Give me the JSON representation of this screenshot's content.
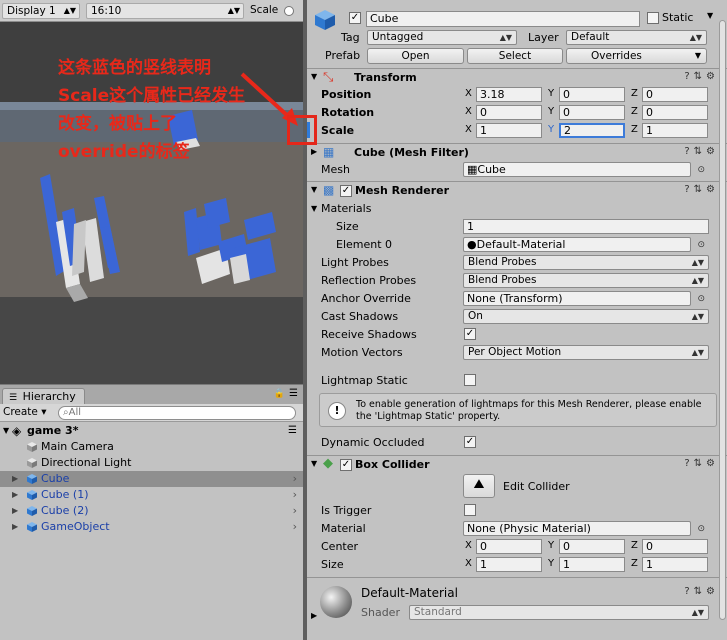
{
  "game_toolbar": {
    "display": "Display 1",
    "resolution": "16:10",
    "scale_label": "Scale"
  },
  "annotation": {
    "text": "这条蓝色的竖线表明Scale这个属性已经发生改变，被贴上了override的标签",
    "color": "#e8281a"
  },
  "hierarchy": {
    "tab_label": "Hierarchy",
    "create_label": "Create",
    "search_placeholder": "All",
    "scene_name": "game 3*",
    "items": [
      {
        "name": "Main Camera",
        "selected": false,
        "prefab": false,
        "foldable": false
      },
      {
        "name": "Directional Light",
        "selected": false,
        "prefab": false,
        "foldable": false
      },
      {
        "name": "Cube",
        "selected": true,
        "prefab": true,
        "foldable": true
      },
      {
        "name": "Cube (1)",
        "selected": false,
        "prefab": true,
        "foldable": true
      },
      {
        "name": "Cube (2)",
        "selected": false,
        "prefab": true,
        "foldable": true
      },
      {
        "name": "GameObject",
        "selected": false,
        "prefab": true,
        "foldable": true
      }
    ]
  },
  "inspector": {
    "object_name": "Cube",
    "static_label": "Static",
    "tag_label": "Tag",
    "tag_value": "Untagged",
    "layer_label": "Layer",
    "layer_value": "Default",
    "prefab_label": "Prefab",
    "open_btn": "Open",
    "select_btn": "Select",
    "overrides_btn": "Overrides",
    "transform": {
      "title": "Transform",
      "position_label": "Position",
      "rotation_label": "Rotation",
      "scale_label": "Scale",
      "position": [
        "3.18",
        "0",
        "0"
      ],
      "rotation": [
        "0",
        "0",
        "0"
      ],
      "scale": [
        "1",
        "2",
        "1"
      ]
    },
    "axes": [
      "X",
      "Y",
      "Z"
    ],
    "mesh_filter": {
      "title": "Cube (Mesh Filter)",
      "mesh_label": "Mesh",
      "mesh_value": "Cube"
    },
    "mesh_renderer": {
      "title": "Mesh Renderer",
      "materials_label": "Materials",
      "size_label": "Size",
      "size_value": "1",
      "element0_label": "Element 0",
      "element0_value": "Default-Material",
      "light_probes_label": "Light Probes",
      "light_probes_value": "Blend Probes",
      "reflection_probes_label": "Reflection Probes",
      "reflection_probes_value": "Blend Probes",
      "anchor_override_label": "Anchor Override",
      "anchor_override_value": "None (Transform)",
      "cast_shadows_label": "Cast Shadows",
      "cast_shadows_value": "On",
      "receive_shadows_label": "Receive Shadows",
      "motion_vectors_label": "Motion Vectors",
      "motion_vectors_value": "Per Object Motion",
      "lightmap_static_label": "Lightmap Static",
      "help_text": "To enable generation of lightmaps for this Mesh Renderer, please enable the 'Lightmap Static' property.",
      "dynamic_occluded_label": "Dynamic Occluded"
    },
    "box_collider": {
      "title": "Box Collider",
      "edit_label": "Edit Collider",
      "is_trigger_label": "Is Trigger",
      "material_label": "Material",
      "material_value": "None (Physic Material)",
      "center_label": "Center",
      "center": [
        "0",
        "0",
        "0"
      ],
      "size_label": "Size",
      "size": [
        "1",
        "1",
        "1"
      ]
    },
    "material": {
      "name": "Default-Material",
      "shader_label": "Shader",
      "shader_value": "Standard"
    }
  },
  "colors": {
    "override_blue": "#2f7bdb",
    "highlight_red": "#e4271a",
    "prefab_text": "#1a3fa8"
  }
}
